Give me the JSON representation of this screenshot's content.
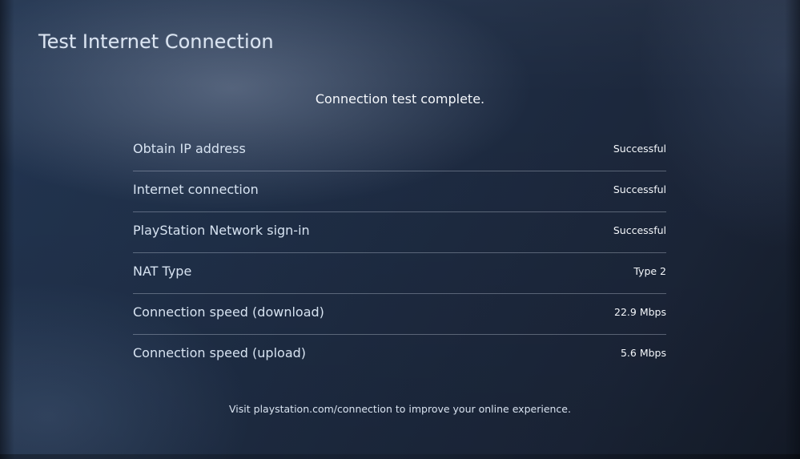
{
  "screen": {
    "title": "Test Internet Connection",
    "status_message": "Connection test complete.",
    "footer_note": "Visit playstation.com/connection to improve your online experience."
  },
  "results": [
    {
      "label": "Obtain IP address",
      "value": "Successful"
    },
    {
      "label": "Internet connection",
      "value": "Successful"
    },
    {
      "label": "PlayStation Network sign-in",
      "value": "Successful"
    },
    {
      "label": "NAT Type",
      "value": "Type 2"
    },
    {
      "label": "Connection speed (download)",
      "value": "22.9 Mbps"
    },
    {
      "label": "Connection speed (upload)",
      "value": "5.6 Mbps"
    }
  ]
}
